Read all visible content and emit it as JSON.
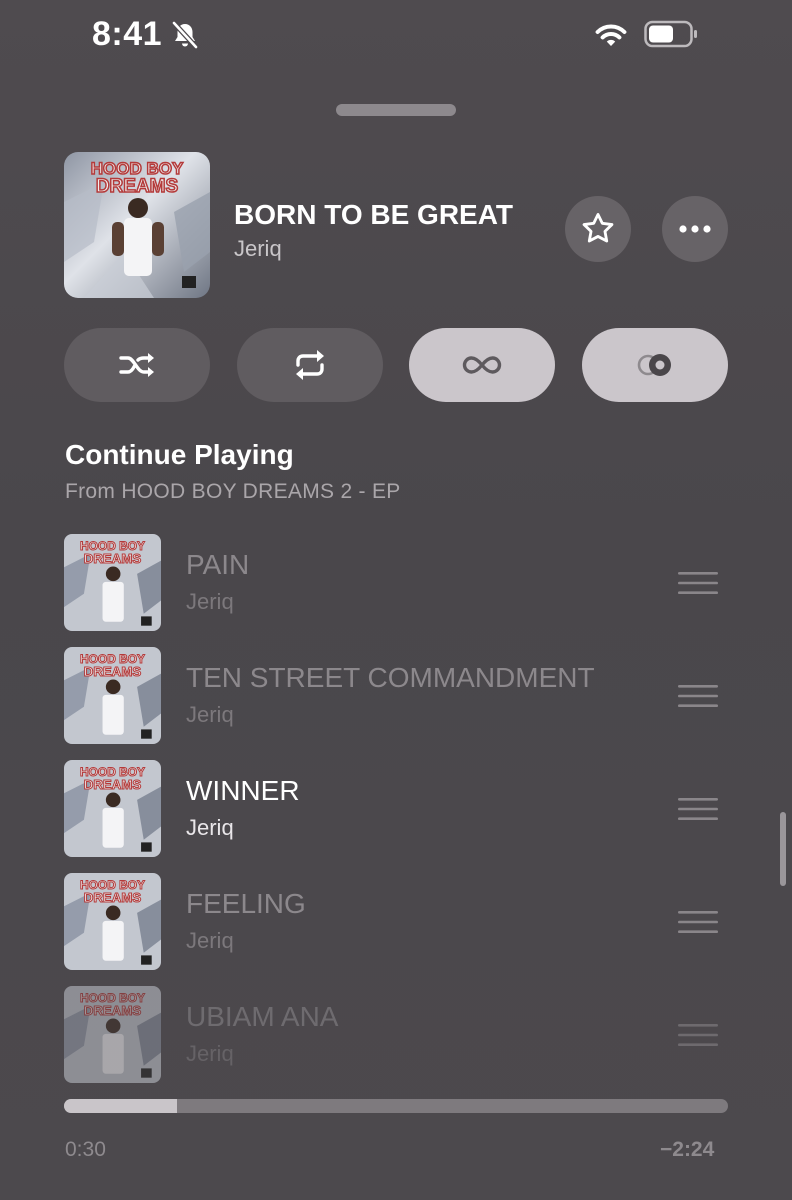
{
  "status_bar": {
    "time": "8:41"
  },
  "now_playing": {
    "title": "BORN TO BE GREAT",
    "artist": "Jeriq"
  },
  "controls": [
    "shuffle",
    "repeat",
    "autoplay-infinity",
    "crossfade"
  ],
  "queue": {
    "title": "Continue Playing",
    "subtitle": "From HOOD BOY DREAMS 2 - EP",
    "tracks": [
      {
        "title": "PAIN",
        "artist": "Jeriq"
      },
      {
        "title": "TEN STREET COMMANDMENT",
        "artist": "Jeriq"
      },
      {
        "title": "WINNER",
        "artist": "Jeriq"
      },
      {
        "title": "FEELING",
        "artist": "Jeriq"
      },
      {
        "title": "UBIAM ANA",
        "artist": "Jeriq"
      }
    ]
  },
  "playback": {
    "elapsed": "0:30",
    "remaining": "−2:24",
    "progress_fraction": 0.17
  },
  "colors": {
    "background": "#4c494d",
    "accent_pill": "#cbc6cb"
  }
}
